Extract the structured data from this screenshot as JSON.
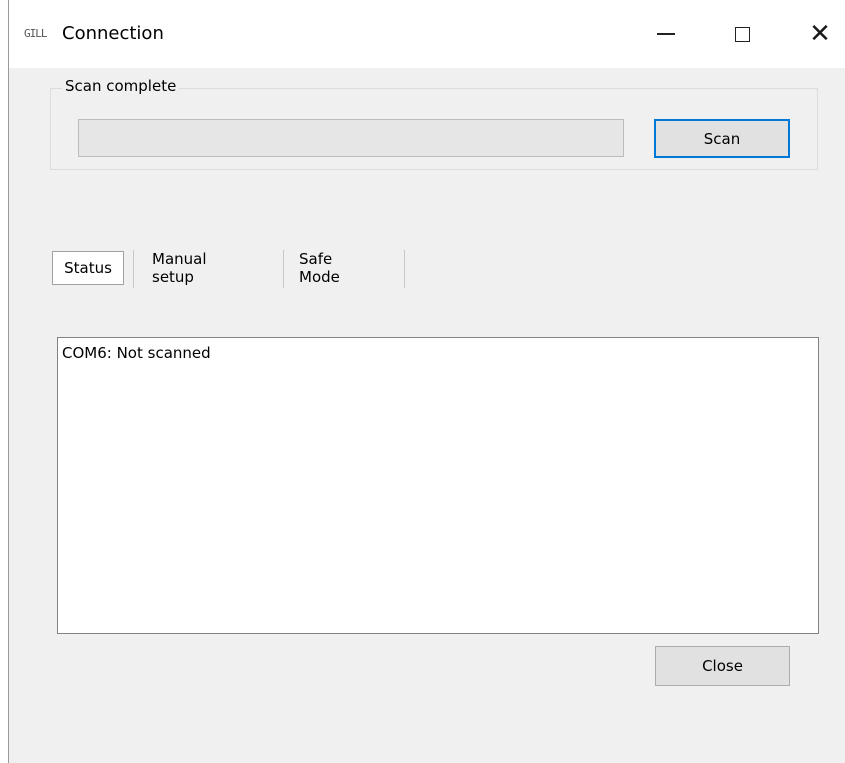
{
  "window": {
    "title": "Connection",
    "app_icon_text": "GILL",
    "controls": {
      "minimize_icon": "minimize-icon",
      "maximize_icon": "maximize-icon",
      "close_icon": "close-icon",
      "close_glyph": "✕"
    }
  },
  "scan_group": {
    "label": "Scan complete",
    "progress": 0,
    "scan_button_label": "Scan"
  },
  "tabs": [
    {
      "label": "Status",
      "active": true
    },
    {
      "label": "Manual setup",
      "active": false
    },
    {
      "label": "Safe Mode",
      "active": false
    }
  ],
  "status_list": {
    "lines": [
      "COM6: Not scanned"
    ]
  },
  "footer": {
    "close_button_label": "Close"
  },
  "colors": {
    "focus_border": "#0078d7",
    "window_bg": "#f0f0f0"
  }
}
